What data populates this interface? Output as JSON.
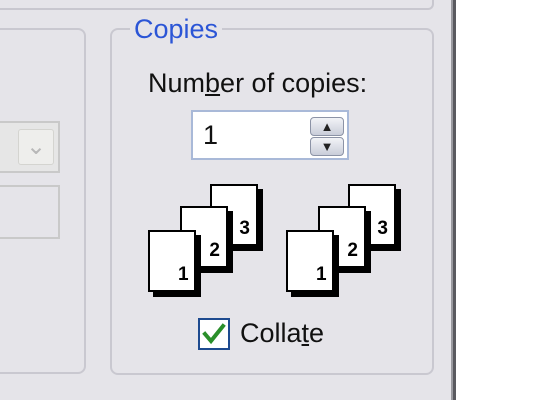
{
  "copies": {
    "group_title": "Copies",
    "number_label_pre": "Num",
    "number_label_accel": "b",
    "number_label_post": "er of copies:",
    "number_value": "1",
    "collate_label_pre": "Colla",
    "collate_label_accel": "t",
    "collate_label_post": "e",
    "collate_checked": true,
    "page_numbers": [
      "1",
      "2",
      "3"
    ]
  },
  "icons": {
    "spin_up": "spin-up-arrow",
    "spin_down": "spin-down-arrow",
    "checkmark": "checkmark",
    "combo_arrow": "chevron-down"
  },
  "colors": {
    "group_title": "#2b55d6",
    "checkmark": "#2a8f2a",
    "dialog_bg": "#e5e4e9"
  }
}
